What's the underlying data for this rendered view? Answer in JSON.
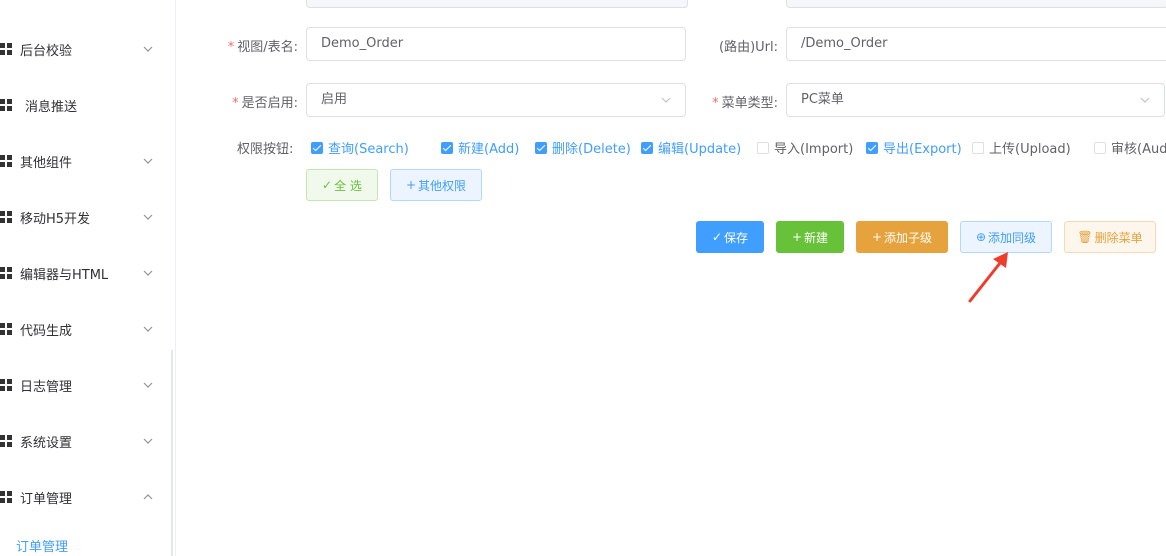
{
  "sidebar": {
    "items": [
      {
        "label": "后台校验",
        "has_chevron": true,
        "expanded": false
      },
      {
        "label": "消息推送",
        "has_chevron": false,
        "expanded": false
      },
      {
        "label": "其他组件",
        "has_chevron": true,
        "expanded": false
      },
      {
        "label": "移动H5开发",
        "has_chevron": true,
        "expanded": false
      },
      {
        "label": "编辑器与HTML",
        "has_chevron": true,
        "expanded": false
      },
      {
        "label": "代码生成",
        "has_chevron": true,
        "expanded": false
      },
      {
        "label": "日志管理",
        "has_chevron": true,
        "expanded": false
      },
      {
        "label": "系统设置",
        "has_chevron": true,
        "expanded": false
      },
      {
        "label": "订单管理",
        "has_chevron": true,
        "expanded": true
      }
    ],
    "active_subitem": "订单管理"
  },
  "form": {
    "view_table": {
      "label": "视图/表名:",
      "required": true,
      "value": "Demo_Order"
    },
    "route_url": {
      "label": "(路由)Url:",
      "required": false,
      "value": "/Demo_Order"
    },
    "enabled": {
      "label": "是否启用:",
      "required": true,
      "value": "启用"
    },
    "menu_type": {
      "label": "菜单类型:",
      "required": true,
      "value": "PC菜单"
    },
    "permissions": {
      "label": "权限按钮:",
      "options": [
        {
          "label": "查询(Search)",
          "checked": true
        },
        {
          "label": "新建(Add)",
          "checked": true
        },
        {
          "label": "删除(Delete)",
          "checked": true
        },
        {
          "label": "编辑(Update)",
          "checked": true
        },
        {
          "label": "导入(Import)",
          "checked": false
        },
        {
          "label": "导出(Export)",
          "checked": true
        },
        {
          "label": "上传(Upload)",
          "checked": false
        },
        {
          "label": "审核(Aud",
          "checked": false
        }
      ],
      "select_all_label": "全 选",
      "other_perm_label": "其他权限"
    }
  },
  "actions": {
    "save": "保存",
    "new": "新建",
    "add_child": "添加子级",
    "add_sibling": "添加同级",
    "delete_menu": "删除菜单"
  },
  "colors": {
    "primary": "#409eff",
    "success": "#67c23a",
    "warning": "#e6a23c",
    "danger": "#f56c6c",
    "annotation_arrow": "#f03c2a"
  }
}
